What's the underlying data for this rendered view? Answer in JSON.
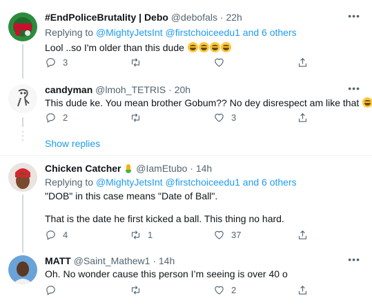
{
  "tweets": [
    {
      "name": "#EndPoliceBrutality | Debo",
      "handle": "@debofals",
      "time": "· 22h",
      "replying_prefix": "Replying to",
      "replying_links": "@MightyJetsInt @firstchoiceedu1",
      "replying_suffix": "and 6 others",
      "text": "Lool ..so I'm older than this dude",
      "reply_count": "3",
      "retweet_count": "",
      "like_count": "",
      "avatar_colors": [
        "#2e8b3e",
        "#c8102e"
      ]
    },
    {
      "name": "candyman",
      "handle": "@lmoh_TETRIS",
      "time": "· 20h",
      "text": "This dude ke. You mean brother Gobum?? No dey disrespect am like that",
      "reply_count": "2",
      "retweet_count": "",
      "like_count": "3",
      "show_replies": "Show replies"
    },
    {
      "name": "Chicken Catcher",
      "handle": "@IamEtubo",
      "time": "· 14h",
      "replying_prefix": "Replying to",
      "replying_links": "@MightyJetsInt @firstchoiceedu1",
      "replying_suffix": "and 6 others",
      "text_line1": "\"DOB\" in this case means \"Date of Ball\".",
      "text_line2": "That is the date he first kicked a ball. This thing no hard.",
      "reply_count": "4",
      "retweet_count": "1",
      "like_count": "37"
    },
    {
      "name": "MATT",
      "handle": "@Saint_Mathew1",
      "time": "· 14h",
      "text": "Oh. No wonder cause this person I’m seeing is over 40 o",
      "reply_count": "",
      "retweet_count": "",
      "like_count": "2"
    }
  ],
  "icons": {
    "reply": "reply-icon",
    "retweet": "retweet-icon",
    "like": "heart-icon",
    "share": "share-icon",
    "more": "more-icon"
  },
  "colors": {
    "link": "#1d9bf0",
    "muted": "#536471",
    "text": "#0f1419",
    "thread_line": "#cfd9de"
  }
}
